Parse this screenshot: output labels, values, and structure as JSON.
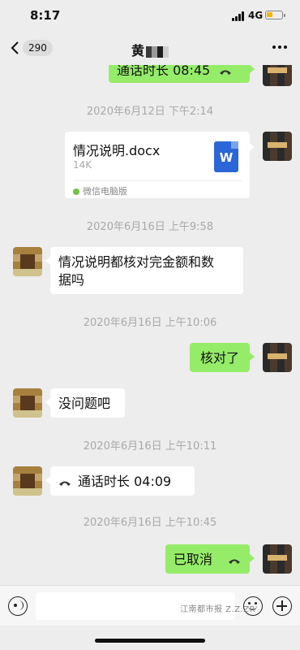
{
  "status": {
    "time": "8:17",
    "network": "4G"
  },
  "nav": {
    "back_count": "290",
    "title": "黄"
  },
  "messages": {
    "call_top": "通话时长 08:45",
    "ts1": "2020年6月12日 下午2:14",
    "file": {
      "name": "情况说明.docx",
      "size": "14K",
      "source": "微信电脑版",
      "icon_text": "W"
    },
    "ts2": "2020年6月16日 上午9:58",
    "msg1_line1": "情况说明都核对完金额和数",
    "msg1_line2": "据吗",
    "ts3": "2020年6月16日 上午10:06",
    "reply1": "核对了",
    "msg2": "没问题吧",
    "ts4": "2020年6月16日 上午10:11",
    "call_incoming": "通话时长 04:09",
    "ts5": "2020年6月16日 上午10:45",
    "cancelled": "已取消"
  },
  "watermark": "江南都市报 Z.Z.ZR",
  "icons": {
    "back": "chevron-left-icon",
    "more": "more-dots-icon",
    "phone": "phone-icon",
    "voice": "voice-icon",
    "emoji": "emoji-icon",
    "plus": "plus-icon",
    "word": "word-file-icon"
  },
  "colors": {
    "sent_bubble": "#95ec69",
    "received_bubble": "#ffffff",
    "background": "#ededed"
  }
}
